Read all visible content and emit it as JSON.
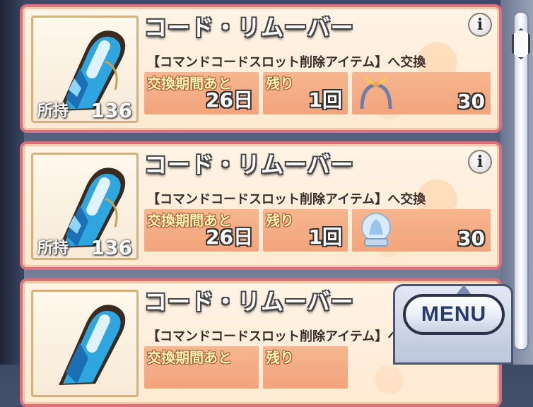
{
  "items": [
    {
      "title": "コード・リムーバー",
      "info_label": "i",
      "description": "【コマンドコードスロット削除アイテム】へ交換",
      "owned_label": "所持",
      "owned_count": "136",
      "period_label": "交換期間あと",
      "period_value": "26日",
      "remaining_label": "残り",
      "remaining_value": "1回",
      "cost_icon": "winged-headband-icon",
      "cost_value": "30"
    },
    {
      "title": "コード・リムーバー",
      "info_label": "i",
      "description": "【コマンドコードスロット削除アイテム】へ交換",
      "owned_label": "所持",
      "owned_count": "136",
      "period_label": "交換期間あと",
      "period_value": "26日",
      "remaining_label": "残り",
      "remaining_value": "1回",
      "cost_icon": "snow-globe-icon",
      "cost_value": "30"
    },
    {
      "title": "コード・リムーバー",
      "description": "【コマンドコードスロット削除アイテム】へ交換",
      "period_label": "交換期間あと",
      "remaining_label": "残り"
    }
  ],
  "menu": {
    "label": "MENU"
  },
  "icons": {
    "item": "code-remover-icon",
    "scroll": "scrollbar-thumb"
  },
  "colors": {
    "card_border": "#d9727e",
    "card_bg": "#fff4e6",
    "stat_bg": "#f3a47c",
    "menu_text": "#273a6e"
  }
}
